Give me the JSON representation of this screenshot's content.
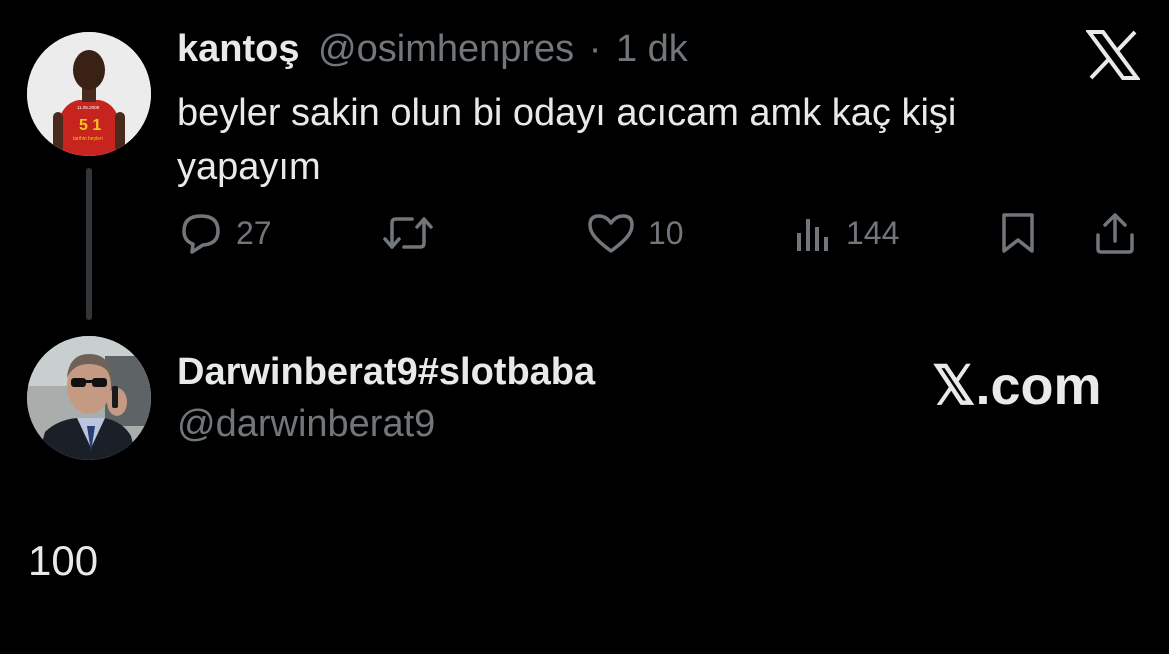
{
  "original_tweet": {
    "author_name": "kantoş",
    "handle": "@osimhenpres",
    "separator": "·",
    "time": "1 dk",
    "text": "beyler sakin olun bi odayı acıcam amk kaç kişi yapayım",
    "avatar_shirt_text": "5 1",
    "avatar_date": "11.05.2008",
    "avatar_caption": "tarihin beyleri",
    "avatar_icon": "person-red-shirt-avatar",
    "logo_icon": "x-logo-icon",
    "actions": {
      "reply_count": "27",
      "retweet_count": "",
      "like_count": "10",
      "views_count": "144"
    }
  },
  "reply": {
    "author_name": "Darwinberat9#slotbaba",
    "handle": "@darwinberat9",
    "watermark": "𝕏.com",
    "text": "100",
    "avatar_icon": "man-sunglasses-phone-avatar"
  },
  "colors": {
    "background": "#000000",
    "text": "#e7e9ea",
    "muted": "#71767b",
    "shirt_red": "#c8241f"
  }
}
